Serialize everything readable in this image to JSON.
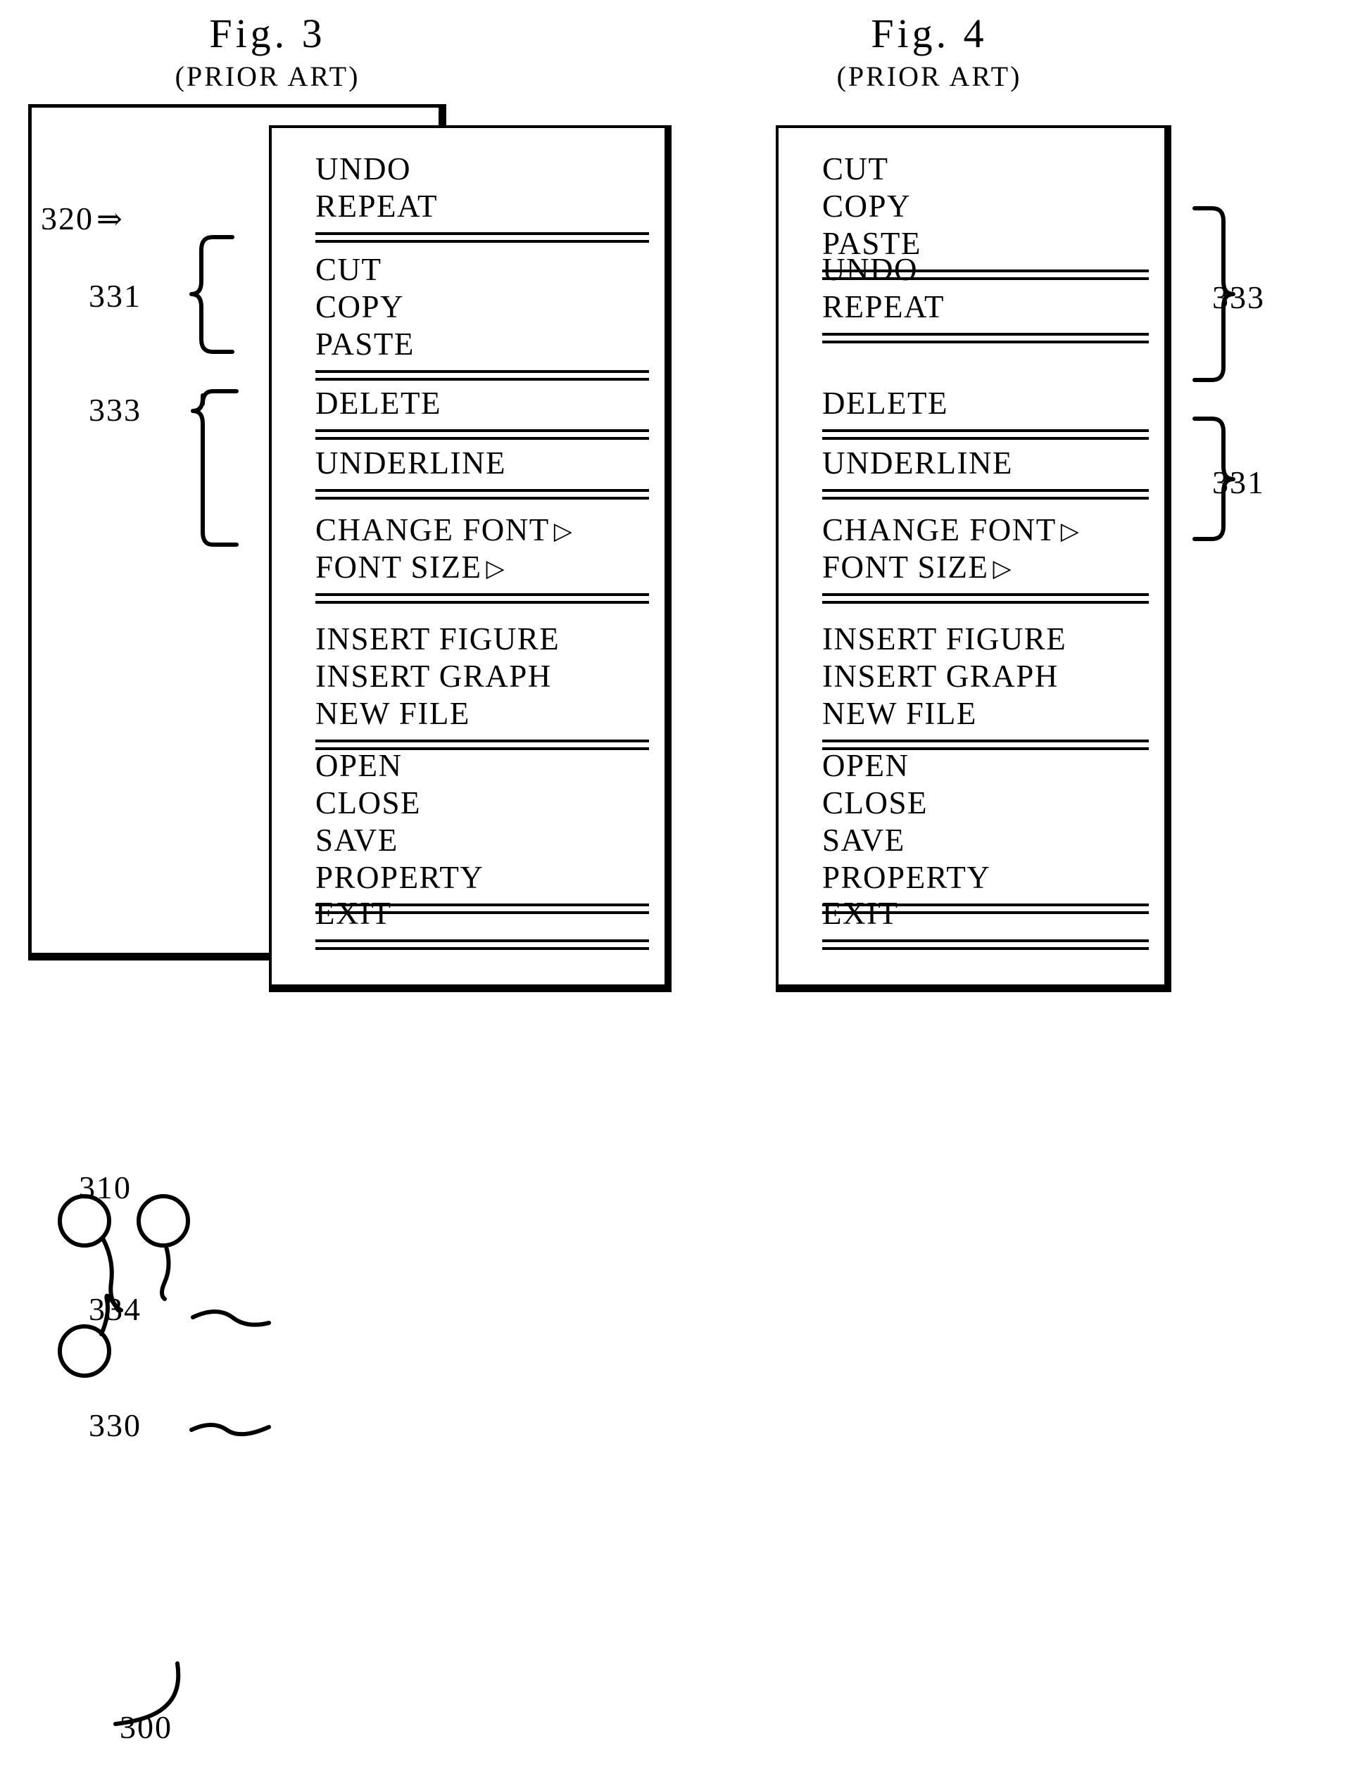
{
  "figures": [
    {
      "id": "fig3",
      "title": "Fig. 3",
      "subtitle": "(PRIOR ART)",
      "window_ref": "300",
      "menu_ref": "330",
      "pointer_ref": "320",
      "pointer_arrow": "⇒",
      "cursor_group_ref": "310",
      "highlight_item_ref": "334",
      "group_labels": [
        {
          "ref": "331",
          "items": [
            "UNDO",
            "REPEAT"
          ]
        },
        {
          "ref": "333",
          "items": [
            "CUT",
            "COPY",
            "PASTE"
          ]
        }
      ],
      "menu_groups": [
        {
          "items": [
            {
              "label": "UNDO",
              "submenu": false
            },
            {
              "label": "REPEAT",
              "submenu": false
            }
          ]
        },
        {
          "items": [
            {
              "label": "CUT",
              "submenu": false
            },
            {
              "label": "COPY",
              "submenu": false
            },
            {
              "label": "PASTE",
              "submenu": false
            }
          ]
        },
        {
          "items": [
            {
              "label": "DELETE",
              "submenu": false
            }
          ]
        },
        {
          "items": [
            {
              "label": "UNDERLINE",
              "submenu": false
            }
          ]
        },
        {
          "items": [
            {
              "label": "CHANGE FONT",
              "submenu": true
            },
            {
              "label": "FONT SIZE",
              "submenu": true
            }
          ]
        },
        {
          "items": [
            {
              "label": "INSERT FIGURE",
              "submenu": false
            },
            {
              "label": "INSERT GRAPH",
              "submenu": false
            },
            {
              "label": "NEW FILE",
              "submenu": false
            }
          ]
        },
        {
          "items": [
            {
              "label": "OPEN",
              "submenu": false
            },
            {
              "label": "CLOSE",
              "submenu": false
            },
            {
              "label": "SAVE",
              "submenu": false
            },
            {
              "label": "PROPERTY",
              "submenu": false
            }
          ]
        },
        {
          "items": [
            {
              "label": "EXIT",
              "submenu": false
            }
          ]
        }
      ]
    },
    {
      "id": "fig4",
      "title": "Fig. 4",
      "subtitle": "(PRIOR ART)",
      "group_labels": [
        {
          "ref": "333",
          "items": [
            "CUT",
            "COPY",
            "PASTE"
          ]
        },
        {
          "ref": "331",
          "items": [
            "UNDO",
            "REPEAT"
          ]
        }
      ],
      "menu_groups": [
        {
          "items": [
            {
              "label": "CUT",
              "submenu": false
            },
            {
              "label": "COPY",
              "submenu": false
            },
            {
              "label": "PASTE",
              "submenu": false
            }
          ]
        },
        {
          "items": [
            {
              "label": "UNDO",
              "submenu": false
            },
            {
              "label": "REPEAT",
              "submenu": false
            }
          ]
        },
        {
          "items": [
            {
              "label": "DELETE",
              "submenu": false
            }
          ]
        },
        {
          "items": [
            {
              "label": "UNDERLINE",
              "submenu": false
            }
          ]
        },
        {
          "items": [
            {
              "label": "CHANGE FONT",
              "submenu": true
            },
            {
              "label": "FONT SIZE",
              "submenu": true
            }
          ]
        },
        {
          "items": [
            {
              "label": "INSERT FIGURE",
              "submenu": false
            },
            {
              "label": "INSERT GRAPH",
              "submenu": false
            },
            {
              "label": "NEW FILE",
              "submenu": false
            }
          ]
        },
        {
          "items": [
            {
              "label": "OPEN",
              "submenu": false
            },
            {
              "label": "CLOSE",
              "submenu": false
            },
            {
              "label": "SAVE",
              "submenu": false
            },
            {
              "label": "PROPERTY",
              "submenu": false
            }
          ]
        },
        {
          "items": [
            {
              "label": "EXIT",
              "submenu": false
            }
          ]
        }
      ]
    }
  ],
  "glyphs": {
    "submenu_arrow": "▷",
    "double_arrow": "⇒"
  },
  "colors": {
    "ink": "#000000",
    "paper": "#ffffff"
  }
}
